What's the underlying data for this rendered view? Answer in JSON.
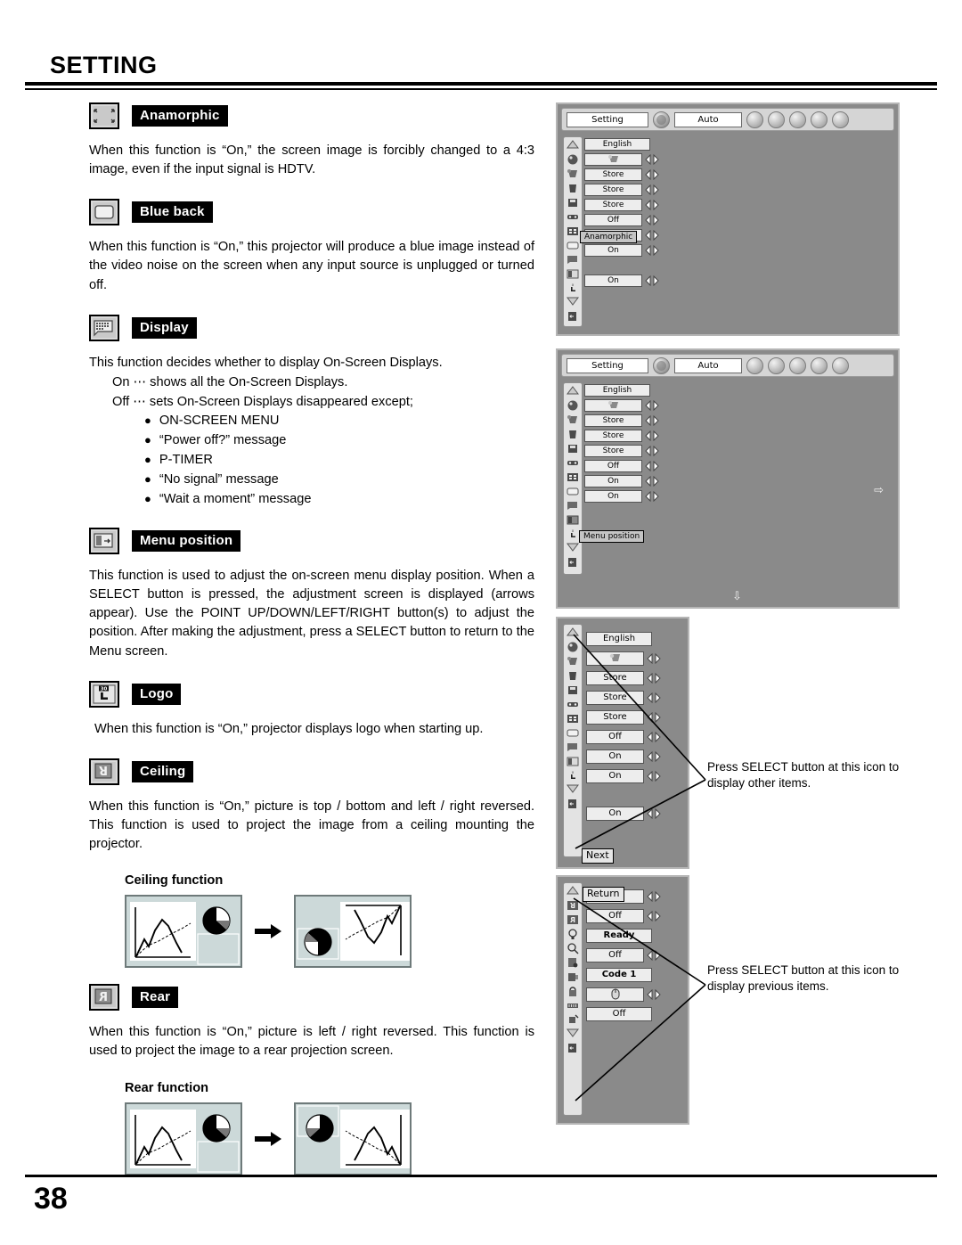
{
  "page": {
    "title": "SETTING",
    "number": "38"
  },
  "sections": [
    {
      "id": "anamorphic",
      "icon": "anamorphic-icon",
      "label": "Anamorphic",
      "body": "When this function is “On,” the screen image is forcibly changed to a 4:3 image, even if the input signal is HDTV."
    },
    {
      "id": "blue-back",
      "icon": "blue-back-icon",
      "label": "Blue back",
      "body": "When this function is “On,” this projector will produce a blue image instead of the video noise on the screen when any input source is unplugged or turned off."
    },
    {
      "id": "display",
      "icon": "display-icon",
      "label": "Display",
      "body": "This function decides whether to display On-Screen Displays.",
      "on_line": "On  ⋯ shows all the On-Screen Displays.",
      "off_line": "Off ⋯ sets On-Screen Displays disappeared except;",
      "bullets": [
        "ON-SCREEN MENU",
        "“Power off?” message",
        "P-TIMER",
        "“No signal” message",
        "“Wait a moment” message"
      ]
    },
    {
      "id": "menu-position",
      "icon": "menu-position-icon",
      "label": "Menu position",
      "body": "This function is used to adjust the on-screen menu display position. When a SELECT button is pressed, the adjustment screen is displayed (arrows appear). Use the POINT UP/DOWN/LEFT/RIGHT button(s) to adjust the position. After making the adjustment, press a SELECT button to return to the Menu screen."
    },
    {
      "id": "logo",
      "icon": "logo-icon",
      "label": "Logo",
      "icon_text": "30",
      "body": "When this function is “On,” projector displays logo when starting up."
    },
    {
      "id": "ceiling",
      "icon": "ceiling-icon",
      "label": "Ceiling",
      "body": "When this function is “On,” picture is top / bottom and left / right reversed.  This function is used to project the image from a ceiling mounting the projector.",
      "figure_title": "Ceiling function"
    },
    {
      "id": "rear",
      "icon": "rear-icon",
      "label": "Rear",
      "body": "When this function is “On,” picture is left / right reversed.  This function is used to project the image to a rear projection screen.",
      "figure_title": "Rear function"
    }
  ],
  "osd": {
    "topbar": {
      "tab_setting": "Setting",
      "tab_auto": "Auto",
      "gear_icon": "gear-icon",
      "icons": [
        "bar-graph-icon",
        "color-wheel-icon",
        "screen-icon",
        "sound-icon",
        "setting-gear-icon"
      ]
    },
    "sidebar_icons_main": [
      "scroll-up-arrow-icon",
      "language-globe-icon",
      "keystone-icon",
      "trash-icon",
      "save-icon",
      "input-icon",
      "anamorphic-icon",
      "blue-back-icon",
      "display-icon",
      "menu-position-icon",
      "logo-icon",
      "scroll-down-arrow-icon",
      "exit-icon"
    ],
    "sidebar_icons_page2": [
      "scroll-up-arrow-icon",
      "ceiling-icon",
      "rear-icon",
      "lamp-icon",
      "lamp-counter-icon",
      "security-icon",
      "remote-icon",
      "lock-icon",
      "power-icon",
      "reset-icon",
      "scroll-down-arrow-icon",
      "exit-icon"
    ],
    "panel1": {
      "name": "osd-panel-anamorphic",
      "rows": [
        {
          "value": "English",
          "arrows": false
        },
        {
          "value": "",
          "arrows": true,
          "icon": "keystone-icon"
        },
        {
          "value": "Store",
          "arrows": true
        },
        {
          "value": "Store",
          "arrows": true
        },
        {
          "value": "Store",
          "arrows": true
        },
        {
          "value": "Off",
          "arrows": true
        },
        {
          "value": "On",
          "arrows": true,
          "tooltip": "Anamorphic"
        },
        {
          "value": "On",
          "arrows": true
        }
      ],
      "last_row": {
        "value": "On",
        "arrows": true
      },
      "tooltip": "Anamorphic"
    },
    "panel2": {
      "name": "osd-panel-menu-position",
      "rows": [
        {
          "value": "English",
          "arrows": false
        },
        {
          "value": "",
          "arrows": true,
          "icon": "keystone-icon"
        },
        {
          "value": "Store",
          "arrows": true
        },
        {
          "value": "Store",
          "arrows": true
        },
        {
          "value": "Store",
          "arrows": true
        },
        {
          "value": "Off",
          "arrows": true
        },
        {
          "value": "On",
          "arrows": true
        },
        {
          "value": "On",
          "arrows": true
        }
      ],
      "tooltip": "Menu position",
      "adjust_arrow_right": "⇨",
      "adjust_arrow_down": "⇩"
    },
    "panel3": {
      "name": "osd-panel-next",
      "rows": [
        {
          "value": "English",
          "arrows": false
        },
        {
          "value": "",
          "arrows": true,
          "icon": "keystone-icon"
        },
        {
          "value": "Store",
          "arrows": true
        },
        {
          "value": "Store",
          "arrows": true
        },
        {
          "value": "Store",
          "arrows": true
        },
        {
          "value": "Off",
          "arrows": true
        },
        {
          "value": "On",
          "arrows": true
        },
        {
          "value": "On",
          "arrows": true
        }
      ],
      "last_row": {
        "value": "On",
        "arrows": true
      },
      "tooltip": "Next",
      "callout": "Press SELECT button at this icon to display other items."
    },
    "panel4": {
      "name": "osd-panel-return",
      "rows": [
        {
          "value": "Off",
          "arrows": true
        },
        {
          "value": "Off",
          "arrows": true
        },
        {
          "value": "Ready",
          "arrows": false
        },
        {
          "value": "Off",
          "arrows": true
        },
        {
          "value": "Code 1",
          "arrows": false
        },
        {
          "value": "",
          "arrows": true,
          "icon": "mouse-icon"
        },
        {
          "value": "Off",
          "arrows": false
        }
      ],
      "tooltip": "Return",
      "callout": "Press SELECT button at this icon to display previous items."
    }
  },
  "colors": {
    "osd_bg": "#8a8a8a",
    "osd_button": "#ededed",
    "figure_bg": "#ccd9d9",
    "icon_bg": "#d9d9d9",
    "label_bg": "#000000"
  }
}
